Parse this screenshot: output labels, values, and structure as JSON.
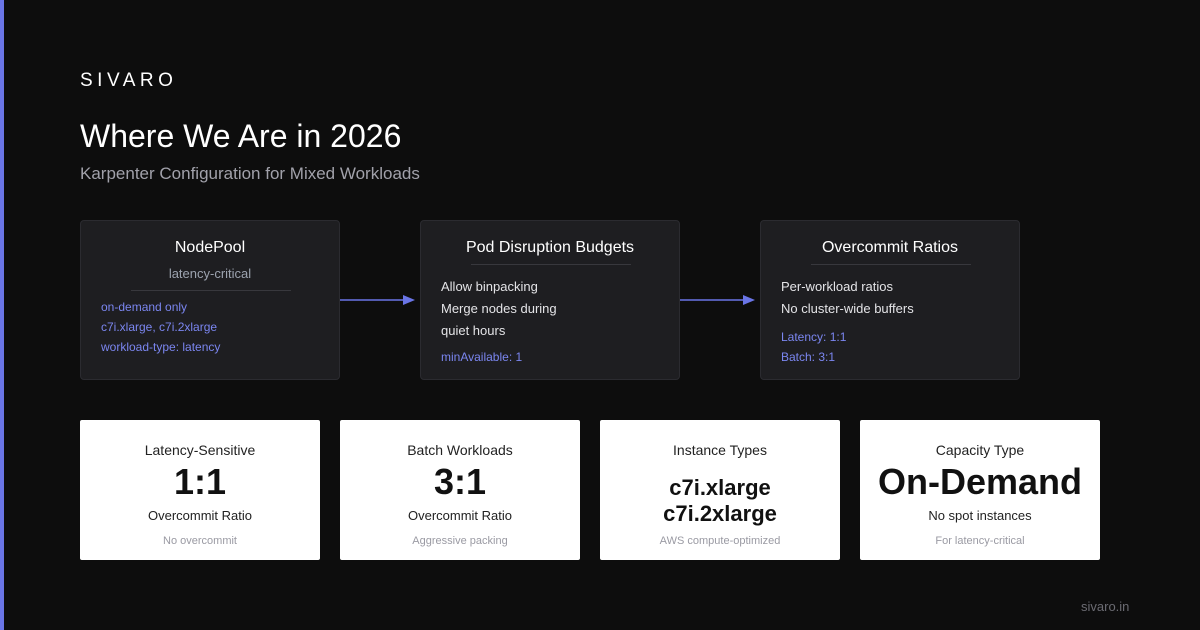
{
  "brand": "SIVARO",
  "title": "Where We Are in 2026",
  "subtitle": "Karpenter Configuration for Mixed Workloads",
  "colors": {
    "accent": "#6a75e6",
    "background": "#0d0d0d",
    "card": "#1e1e21",
    "highlight_text": "#7b86f0"
  },
  "cards": [
    {
      "title": "NodePool",
      "subtitle": "latency-critical",
      "lines": [],
      "details": [
        "on-demand only",
        "c7i.xlarge, c7i.2xlarge",
        "workload-type: latency"
      ]
    },
    {
      "title": "Pod Disruption Budgets",
      "lines": [
        "Allow binpacking",
        "Merge nodes during",
        "quiet hours"
      ],
      "details": [
        "minAvailable: 1"
      ]
    },
    {
      "title": "Overcommit Ratios",
      "lines": [
        "Per-workload ratios",
        "No cluster-wide buffers"
      ],
      "details": [
        "Latency: 1:1",
        "Batch: 3:1"
      ]
    }
  ],
  "stats": [
    {
      "label": "Latency-Sensitive",
      "value": "1:1",
      "desc": "Overcommit Ratio",
      "note": "No overcommit"
    },
    {
      "label": "Batch Workloads",
      "value": "3:1",
      "desc": "Overcommit Ratio",
      "note": "Aggressive packing"
    },
    {
      "label": "Instance Types",
      "value_lines": [
        "c7i.xlarge",
        "c7i.2xlarge"
      ],
      "note": "AWS compute-optimized"
    },
    {
      "label": "Capacity Type",
      "value": "On-Demand",
      "desc": "No spot instances",
      "note": "For latency-critical"
    }
  ],
  "footer": "sivaro.in"
}
